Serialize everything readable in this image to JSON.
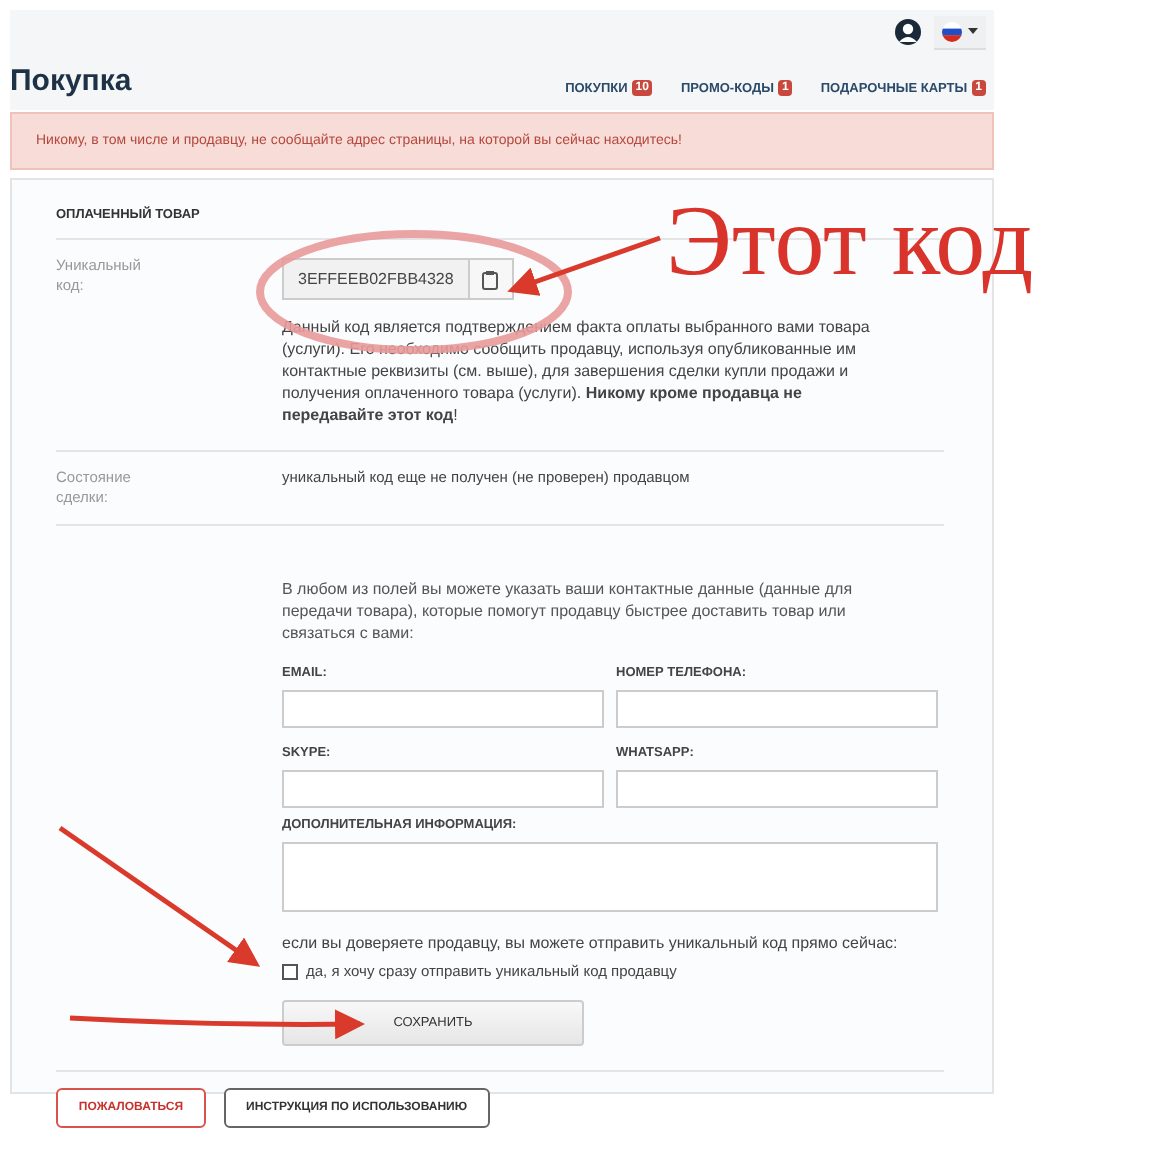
{
  "header": {
    "title": "Покупка",
    "nav": [
      {
        "label": "ПОКУПКИ",
        "count": "10"
      },
      {
        "label": "ПРОМО-КОДЫ",
        "count": "1"
      },
      {
        "label": "ПОДАРОЧНЫЕ КАРТЫ",
        "count": "1"
      }
    ]
  },
  "alert": "Никому, в том числе и продавцу, не сообщайте адрес страницы, на которой вы сейчас находитесь!",
  "card": {
    "section_title": "ОПЛАЧЕННЫЙ ТОВАР",
    "code": {
      "label": "Уникальный код:",
      "value": "3EFFEEB02FBB4328",
      "description": "Данный код является подтверждением факта оплаты выбранного вами товара (услуги). Его необходимо сообщить продавцу, используя опубликованные им контактные реквизиты (см. выше), для завершения сделки купли продажи и получения оплаченного товара (услуги). **Никому кроме продавца не передавайте этот код**!"
    },
    "state": {
      "label": "Состояние сделки:",
      "value": "уникальный код еще не получен (не проверен) продавцом"
    },
    "contacts": {
      "intro": "В любом из полей вы можете указать ваши контактные данные (данные для передачи товара), которые помогут продавцу быстрее доставить товар или связаться с вами:",
      "fields": [
        {
          "label": "EMAIL:"
        },
        {
          "label": "НОМЕР ТЕЛЕФОНА:"
        },
        {
          "label": "SKYPE:"
        },
        {
          "label": "WHATSAPP:"
        }
      ],
      "extra_label": "ДОПОЛНИТЕЛЬНАЯ ИНФОРМАЦИЯ:",
      "trust_text": "если вы доверяете продавцу, вы можете отправить уникальный код прямо сейчас:",
      "checkbox": {
        "label": "да, я хочу сразу отправить уникальный код продавцу",
        "checked": false
      },
      "save_button": "СОХРАНИТЬ"
    },
    "footer_buttons": [
      {
        "label": "ПОЖАЛОВАТЬСЯ",
        "kind": "danger"
      },
      {
        "label": "ИНСТРУКЦИЯ ПО ИСПОЛЬЗОВАНИЮ",
        "kind": "default"
      }
    ]
  },
  "annotation": {
    "text": "Этот код"
  }
}
